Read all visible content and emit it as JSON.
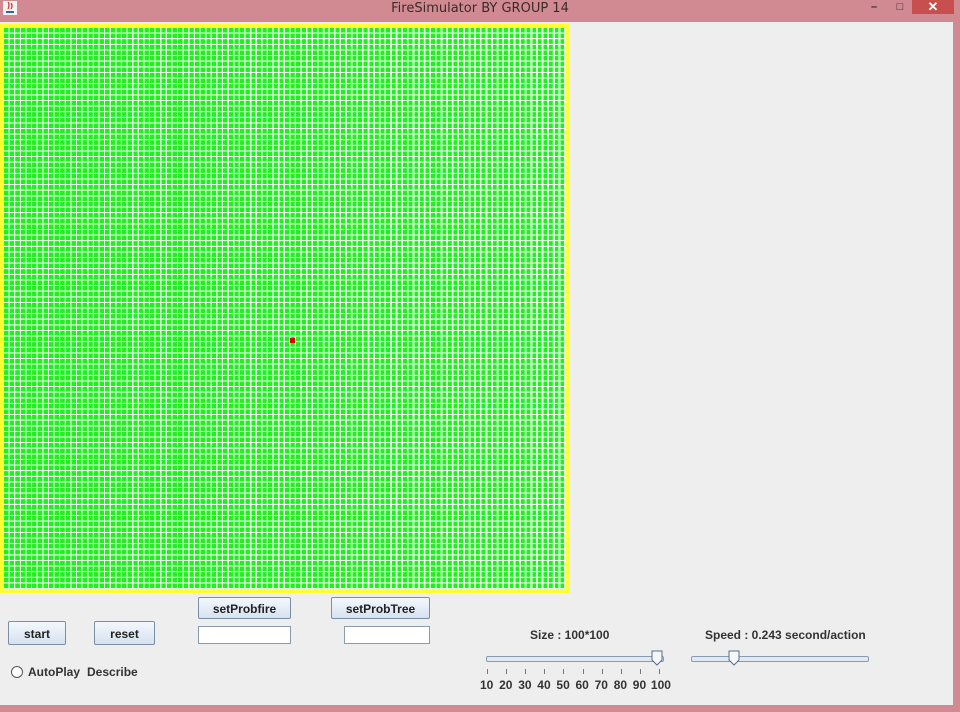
{
  "window": {
    "title": "FireSimulator BY GROUP 14",
    "minimize_glyph": "–",
    "maximize_glyph": "□",
    "close_glyph": "✕"
  },
  "grid": {
    "rows": 100,
    "cols": 100,
    "tree_color": "#22ee22",
    "border_color": "#ffff33",
    "fire_color": "#dd0000"
  },
  "controls": {
    "start_label": "start",
    "reset_label": "reset",
    "setprobfire_label": "setProbfire",
    "setprobtree_label": "setProbTree",
    "probfire_value": "",
    "probtree_value": "",
    "autoplay_label": "AutoPlay",
    "describe_label": "Describe"
  },
  "size_slider": {
    "label": "Size : 100*100",
    "value": 100,
    "min": 10,
    "max": 100,
    "tick_labels": [
      "10",
      "20",
      "30",
      "40",
      "50",
      "60",
      "70",
      "80",
      "90",
      "100"
    ]
  },
  "speed_slider": {
    "label": "Speed : 0.243 second/action",
    "value_fraction": 0.24
  }
}
